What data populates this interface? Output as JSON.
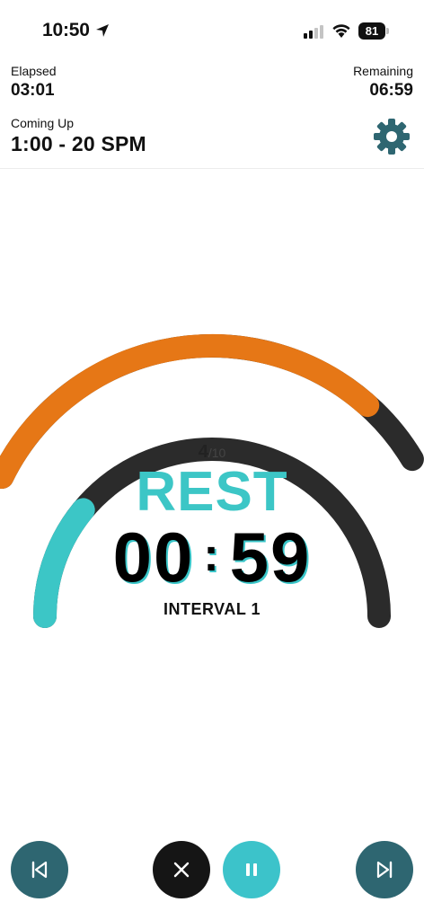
{
  "status": {
    "time": "10:50",
    "battery": "81"
  },
  "header": {
    "elapsed_label": "Elapsed",
    "elapsed_value": "03:01",
    "remaining_label": "Remaining",
    "remaining_value": "06:59",
    "coming_up_label": "Coming Up",
    "coming_up_value": "1:00 - 20 SPM"
  },
  "workout": {
    "interval_current": "4",
    "interval_total": "/10",
    "phase": "REST",
    "timer_minutes": "00",
    "timer_separator": ":",
    "timer_seconds": "59",
    "interval_name": "INTERVAL 1",
    "overall_progress": 0.86,
    "interval_progress": 0.22
  },
  "colors": {
    "accent": "#3cc6c6",
    "progress_orange": "#e67716",
    "track": "#2b2b2b",
    "button_dark_teal": "#2e6671",
    "button_black": "#151515"
  },
  "controls": {
    "prev": "skip-previous-icon",
    "stop": "close-icon",
    "pause": "pause-icon",
    "next": "skip-next-icon"
  }
}
